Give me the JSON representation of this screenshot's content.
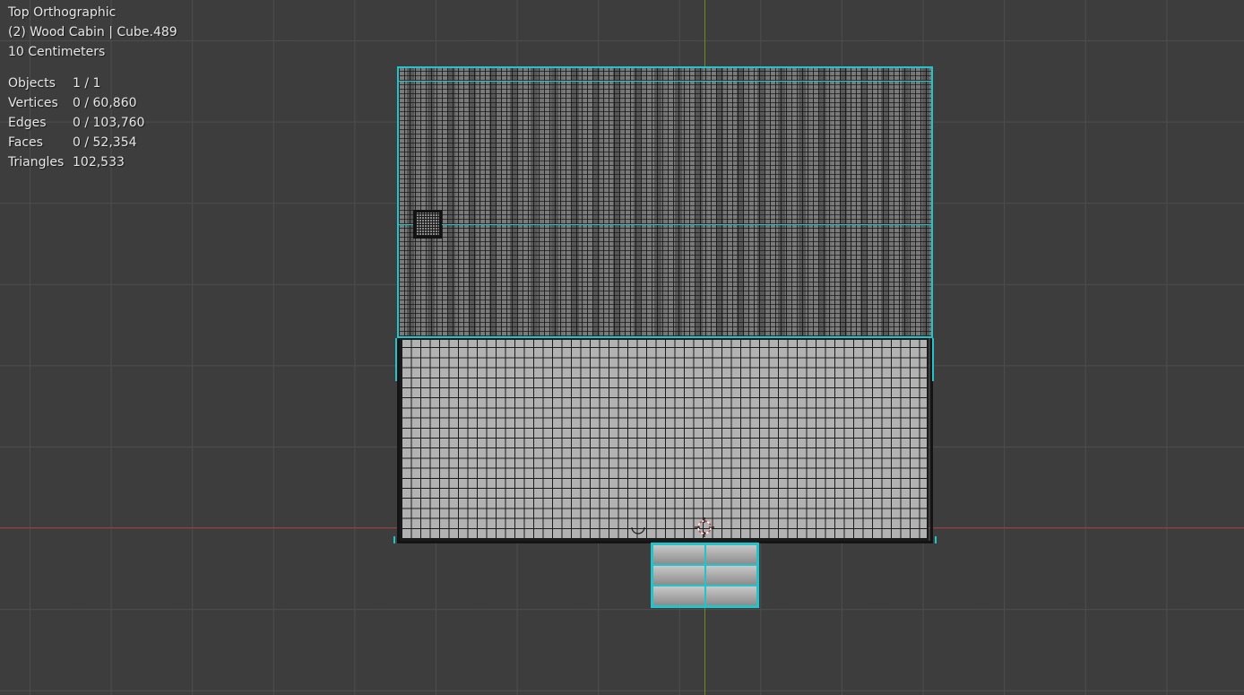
{
  "view": {
    "name": "Top Orthographic",
    "collection_object": "(2) Wood Cabin | Cube.489",
    "grid_scale": "10 Centimeters"
  },
  "stats": [
    {
      "label": "Objects",
      "value": "1 / 1"
    },
    {
      "label": "Vertices",
      "value": "0 / 60,860"
    },
    {
      "label": "Edges",
      "value": "0 / 103,760"
    },
    {
      "label": "Faces",
      "value": "0 / 52,354"
    },
    {
      "label": "Triangles",
      "value": "102,533"
    }
  ],
  "colors": {
    "background": "#3d3d3d",
    "grid": "#4e4e4e",
    "x_axis": "#a13a3a",
    "y_axis": "#6c8a24",
    "selection_outline": "#22c4cc",
    "overlay_text": "#e6e6e6"
  },
  "icons": {
    "cursor": "3d-cursor-icon",
    "origin": "object-origin-icon"
  }
}
